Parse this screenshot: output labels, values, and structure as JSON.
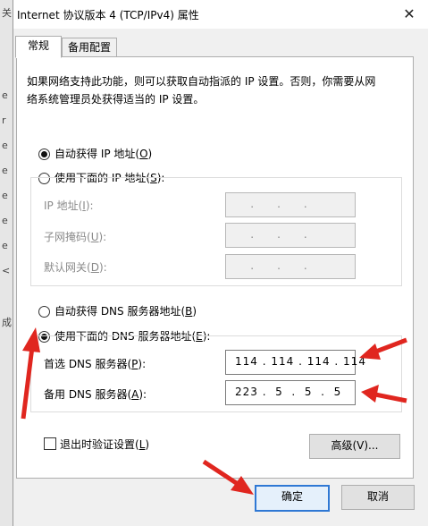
{
  "backdrop": {
    "glyphs": [
      "关",
      "e",
      "r",
      "e",
      "e",
      "e",
      "e",
      "e",
      "<",
      "成"
    ]
  },
  "window": {
    "title": "Internet 协议版本 4 (TCP/IPv4) 属性",
    "close_glyph": "✕"
  },
  "tabs": [
    {
      "label": "常规",
      "active": true
    },
    {
      "label": "备用配置",
      "active": false
    }
  ],
  "description": {
    "line1": "如果网络支持此功能，则可以获取自动指派的 IP 设置。否则，你需要从网",
    "line2": "络系统管理员处获得适当的 IP 设置。"
  },
  "ip_section": {
    "auto_radio": {
      "prefix": "自动获得 IP 地址(",
      "key": "O",
      "suffix": ")",
      "selected": true
    },
    "manual_radio": {
      "prefix": "使用下面的 IP 地址(",
      "key": "S",
      "suffix": "):",
      "selected": false
    },
    "fields": [
      {
        "prefix": "IP 地址(",
        "key": "I",
        "suffix": "):",
        "dots": "...",
        "value": ""
      },
      {
        "prefix": "子网掩码(",
        "key": "U",
        "suffix": "):",
        "dots": "...",
        "value": ""
      },
      {
        "prefix": "默认网关(",
        "key": "D",
        "suffix": "):",
        "dots": "...",
        "value": ""
      }
    ]
  },
  "dns_section": {
    "auto_radio": {
      "prefix": "自动获得 DNS 服务器地址(",
      "key": "B",
      "suffix": ")",
      "selected": false
    },
    "manual_radio": {
      "prefix": "使用下面的 DNS 服务器地址(",
      "key": "E",
      "suffix": "):",
      "selected": true
    },
    "preferred": {
      "prefix": "首选 DNS 服务器(",
      "key": "P",
      "suffix": "):",
      "value": "114 . 114 . 114 . 114"
    },
    "alternate": {
      "prefix": "备用 DNS 服务器(",
      "key": "A",
      "suffix": "):",
      "value": "223 .  5  .  5  .  5"
    }
  },
  "validate_checkbox": {
    "prefix": "退出时验证设置(",
    "key": "L",
    "suffix": ")",
    "checked": false
  },
  "buttons": {
    "advanced": "高级(V)...",
    "ok": "确定",
    "cancel": "取消"
  },
  "annotation_color": "#e0261f"
}
